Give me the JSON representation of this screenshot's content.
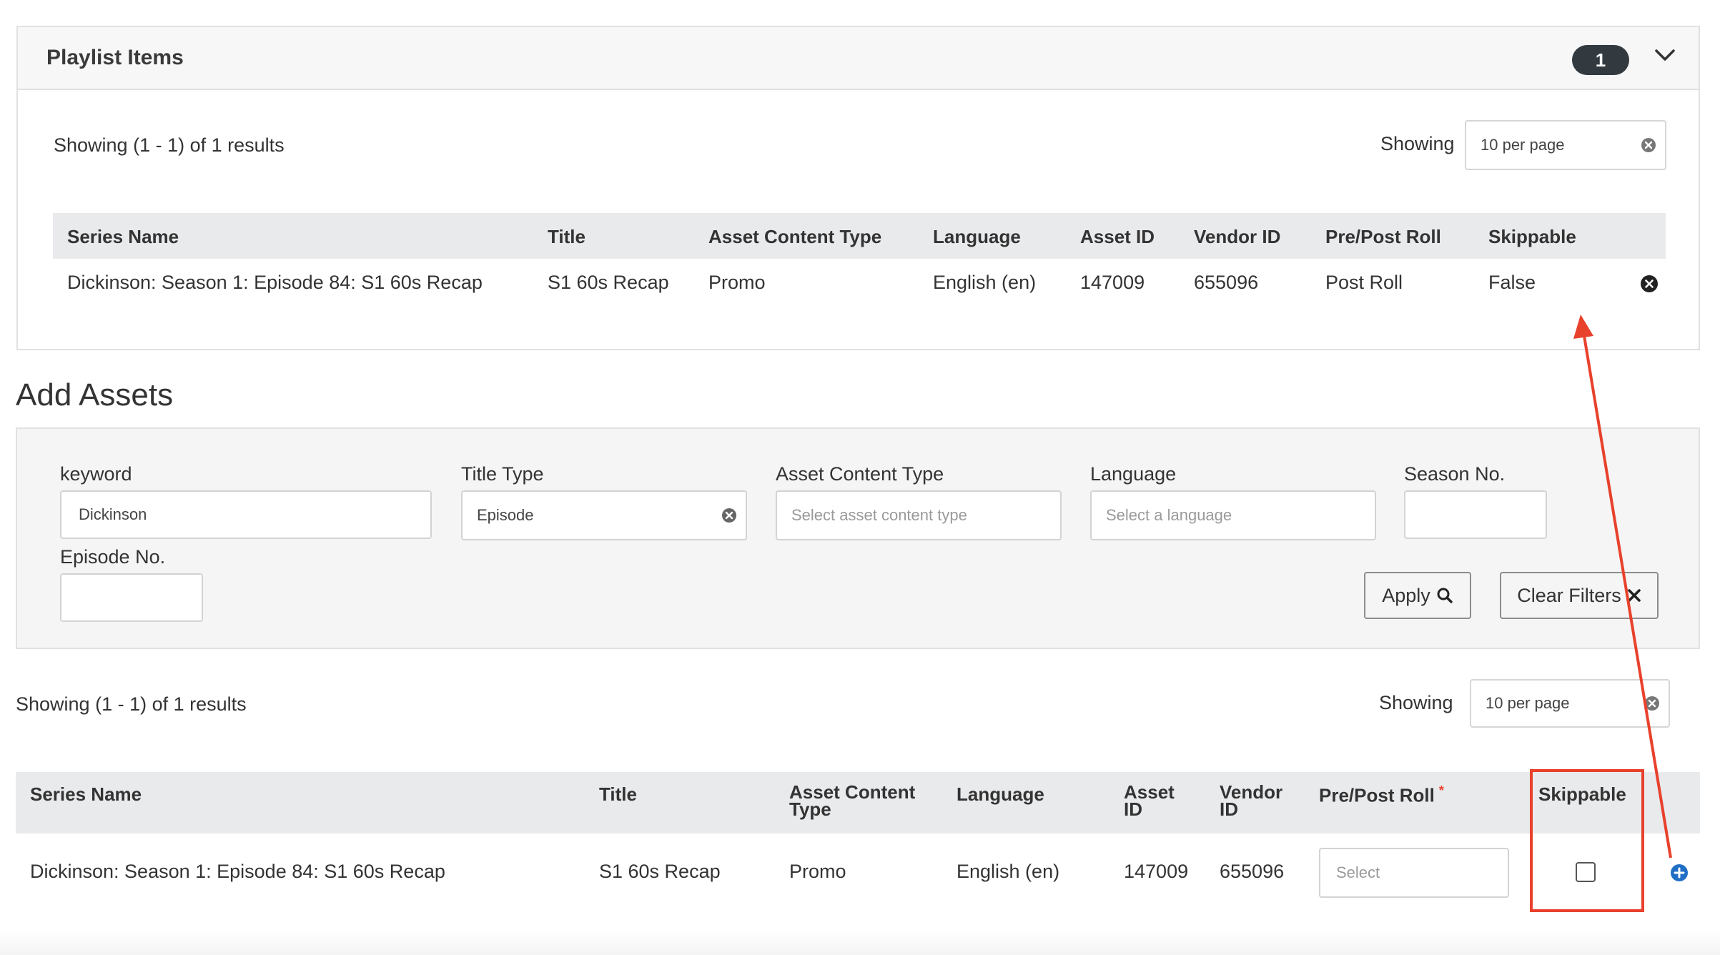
{
  "playlist": {
    "title": "Playlist Items",
    "count": "1",
    "showing_text": "Showing (1 - 1) of 1 results",
    "showing_label": "Showing",
    "per_page": "10 per page",
    "columns": [
      "Series Name",
      "Title",
      "Asset Content Type",
      "Language",
      "Asset ID",
      "Vendor ID",
      "Pre/Post Roll",
      "Skippable"
    ],
    "rows": [
      {
        "series_name": "Dickinson: Season 1: Episode 84: S1 60s Recap",
        "title": "S1 60s Recap",
        "asset_content_type": "Promo",
        "language": "English (en)",
        "asset_id": "147009",
        "vendor_id": "655096",
        "pre_post_roll": "Post Roll",
        "skippable": "False"
      }
    ]
  },
  "add_assets": {
    "title": "Add Assets",
    "filters": {
      "keyword_label": "keyword",
      "keyword_value": "Dickinson",
      "title_type_label": "Title Type",
      "title_type_value": "Episode",
      "asset_content_type_label": "Asset Content Type",
      "asset_content_type_placeholder": "Select asset content type",
      "language_label": "Language",
      "language_placeholder": "Select a language",
      "season_label": "Season No.",
      "season_value": "",
      "episode_label": "Episode No.",
      "episode_value": "",
      "apply_label": "Apply",
      "clear_label": "Clear Filters"
    },
    "showing_text": "Showing (1 - 1) of 1 results",
    "showing_label": "Showing",
    "per_page": "10 per page",
    "columns": {
      "series_name": "Series Name",
      "title": "Title",
      "asset_content_type_1": "Asset Content",
      "asset_content_type_2": "Type",
      "language": "Language",
      "asset_id_1": "Asset",
      "asset_id_2": "ID",
      "vendor_id_1": "Vendor",
      "vendor_id_2": "ID",
      "pre_post_roll": "Pre/Post Roll",
      "required_mark": "*",
      "skippable": "Skippable"
    },
    "rows": [
      {
        "series_name": "Dickinson: Season 1: Episode 84: S1 60s Recap",
        "title": "S1 60s Recap",
        "asset_content_type": "Promo",
        "language": "English (en)",
        "asset_id": "147009",
        "vendor_id": "655096",
        "pre_post_roll_placeholder": "Select",
        "skippable_checked": false
      }
    ]
  },
  "annotation": {
    "color": "#e8412c"
  },
  "icons": {
    "accent_blue": "#1f6fc5",
    "dark": "#333a3f"
  }
}
